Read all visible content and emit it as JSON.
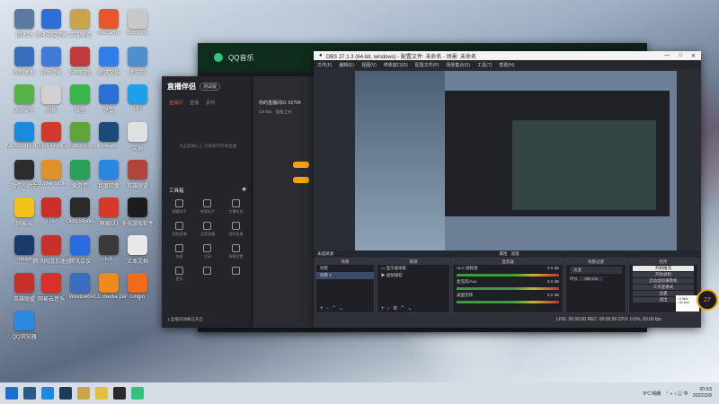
{
  "desktop_icons": [
    {
      "label": "回收站",
      "color": "#5a7aa0"
    },
    {
      "label": "腾讯电脑管家",
      "color": "#2d6ed8"
    },
    {
      "label": "英雄联盟",
      "color": "#c8a44a"
    },
    {
      "label": "WeGame",
      "color": "#e8572a"
    },
    {
      "label": "bobobox",
      "color": "#c8c8c8"
    },
    {
      "label": "控制面板",
      "color": "#3a6fc0"
    },
    {
      "label": "软件管家",
      "color": "#3d7bd7"
    },
    {
      "label": "哔哩哔哩",
      "color": "#c23b3b"
    },
    {
      "label": "腾讯文档",
      "color": "#2d7ee8"
    },
    {
      "label": "此电脑",
      "color": "#4e8fcf"
    },
    {
      "label": "360安全",
      "color": "#58b24a"
    },
    {
      "label": "网易",
      "color": "#d0d0d0"
    },
    {
      "label": "微信",
      "color": "#39b54a"
    },
    {
      "label": "迅雷",
      "color": "#2b70d4"
    },
    {
      "label": "QQ",
      "color": "#1ea0e8"
    },
    {
      "label": "Microsoft Edge",
      "color": "#1a8adc"
    },
    {
      "label": "PotPlayer",
      "color": "#d03a2a"
    },
    {
      "label": "GeForce Experience",
      "color": "#5fa53a"
    },
    {
      "label": "Steam",
      "color": "#1c4a7a"
    },
    {
      "label": "文档",
      "color": "#e0e0e0"
    },
    {
      "label": "微信小助手",
      "color": "#2c2c2c"
    },
    {
      "label": "Counter-Strike",
      "color": "#e0912a"
    },
    {
      "label": "爱奇艺",
      "color": "#2a9f58"
    },
    {
      "label": "百度网盘",
      "color": "#2b86e0"
    },
    {
      "label": "英雄联盟",
      "color": "#b0453a"
    },
    {
      "label": "网易云",
      "color": "#f2c21a"
    },
    {
      "label": "TGP",
      "color": "#c8302a"
    },
    {
      "label": "OBS Studio",
      "color": "#2a2a2a"
    },
    {
      "label": "网易UU",
      "color": "#d4392a"
    },
    {
      "label": "罗技游戏软件",
      "color": "#1c1c1c"
    },
    {
      "label": "Steam",
      "color": "#1a3a6a"
    },
    {
      "label": "腾讯网游加速器",
      "color": "#c8302a"
    },
    {
      "label": "腾讯会议",
      "color": "#2a6ce0"
    },
    {
      "label": "EA",
      "color": "#3a3a3a"
    },
    {
      "label": "文本文档",
      "color": "#e8e8e8"
    },
    {
      "label": "英雄联盟",
      "color": "#c8302a"
    },
    {
      "label": "网易云音乐",
      "color": "#d8302a"
    },
    {
      "label": "Windows",
      "color": "#3a6fc0"
    },
    {
      "label": "VLC media player",
      "color": "#f08a1a"
    },
    {
      "label": "Origin",
      "color": "#f06c1a"
    },
    {
      "label": "QQ浏览器",
      "color": "#2a8ae0"
    }
  ],
  "qq_music": {
    "title": "QQ音乐"
  },
  "live_assistant": {
    "title": "直播伴侣",
    "version": "测试版",
    "tabs": [
      "直播间",
      "直播",
      "素材"
    ],
    "empty_msg": "点击直播以上 内容即可开始直播",
    "tools_label": "工具箱",
    "tools": [
      "弹幕助手",
      "房管助手",
      "主播任务",
      "视频直播",
      "语音直播",
      "游戏直播",
      "连麦",
      "活动",
      "直播设置",
      "更多",
      "",
      ""
    ],
    "footer": "1.直播间弹幕已开启"
  },
  "mid_panel": {
    "line1": "你的直播间ID: 62794",
    "line2": "CS:GO · 竞技上分"
  },
  "obs": {
    "title": "OBS 27.1.3 (64-bit, windows) - 配置文件: 未命名 - 场景: 未命名",
    "menu": [
      "文件(F)",
      "编辑(E)",
      "视图(V)",
      "停靠窗口(D)",
      "配置文件(P)",
      "场景集合(S)",
      "工具(T)",
      "帮助(H)"
    ],
    "scene_tab": "未选择源",
    "dock_buttons": [
      "属性",
      "滤镜"
    ],
    "scenes_title": "场景",
    "scenes": [
      "场景",
      "场景 2"
    ],
    "sources_title": "来源",
    "sources": [
      "显示器采集",
      "视频捕获"
    ],
    "mixer_title": "混音器",
    "mixer": [
      {
        "name": "VLC 视频源",
        "db": "0.0 dB"
      },
      {
        "name": "麦克风/Aux",
        "db": "0.0 dB"
      },
      {
        "name": "桌面音频",
        "db": "0.0 dB"
      }
    ],
    "transitions_title": "场景过渡",
    "transition_type": "淡变",
    "duration_label": "时长",
    "duration": "300 ms",
    "controls_title": "控件",
    "controls": [
      "开始推流",
      "开始录制",
      "启动虚拟摄像机",
      "工作室模式",
      "设置",
      "退出"
    ],
    "status": "LIVE: 00:00:00   REC: 00:00:00   CPU: 0.5%, 60.00 fps",
    "cpu_badge": "27",
    "tooltip": "↑0.3k/s ↓40.1k/s"
  },
  "taskbar": {
    "weather": "9°C 晴朗",
    "time": "20:53",
    "date": "2022/2/9"
  }
}
